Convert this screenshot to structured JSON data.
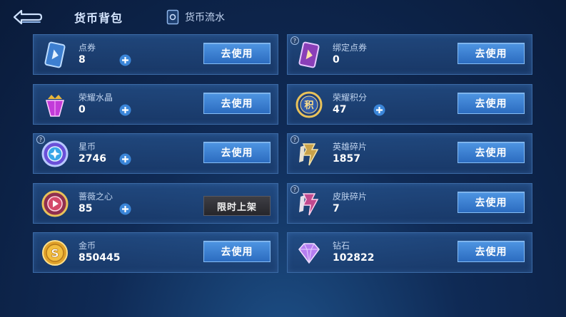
{
  "header": {
    "title": "货币背包",
    "flow_tab_label": "货币流水"
  },
  "items": [
    {
      "name": "点券",
      "count": "8",
      "action_label": "去使用"
    },
    {
      "name": "绑定点券",
      "count": "0",
      "action_label": "去使用"
    },
    {
      "name": "荣耀水晶",
      "count": "0",
      "action_label": "去使用"
    },
    {
      "name": "荣耀积分",
      "count": "47",
      "action_label": "去使用"
    },
    {
      "name": "星币",
      "count": "2746",
      "action_label": "去使用"
    },
    {
      "name": "英雄碎片",
      "count": "1857",
      "action_label": "去使用"
    },
    {
      "name": "蔷薇之心",
      "count": "85",
      "badge_label": "限时上架"
    },
    {
      "name": "皮肤碎片",
      "count": "7",
      "action_label": "去使用"
    },
    {
      "name": "金币",
      "count": "850445",
      "action_label": "去使用"
    },
    {
      "name": "钻石",
      "count": "102822",
      "action_label": "去使用"
    }
  ],
  "icons": {
    "back": "back-arrow-icon",
    "flow": "ledger-icon",
    "help": "question-mark-icon",
    "plus": "plus-icon",
    "voucher": "voucher-card-icon",
    "bound_voucher": "bound-voucher-card-icon",
    "crystal": "glory-crystal-icon",
    "points": "glory-points-icon",
    "star_coin": "star-coin-icon",
    "hero_fragment": "hero-fragment-icon",
    "rose_heart": "rose-heart-icon",
    "skin_fragment": "skin-fragment-icon",
    "gold": "gold-coin-icon",
    "diamond": "diamond-icon"
  },
  "colors": {
    "button": "#3a7fd4",
    "badge": "#2f2f35",
    "background": "#0f2a55",
    "card_border": "#3b6aa6"
  }
}
